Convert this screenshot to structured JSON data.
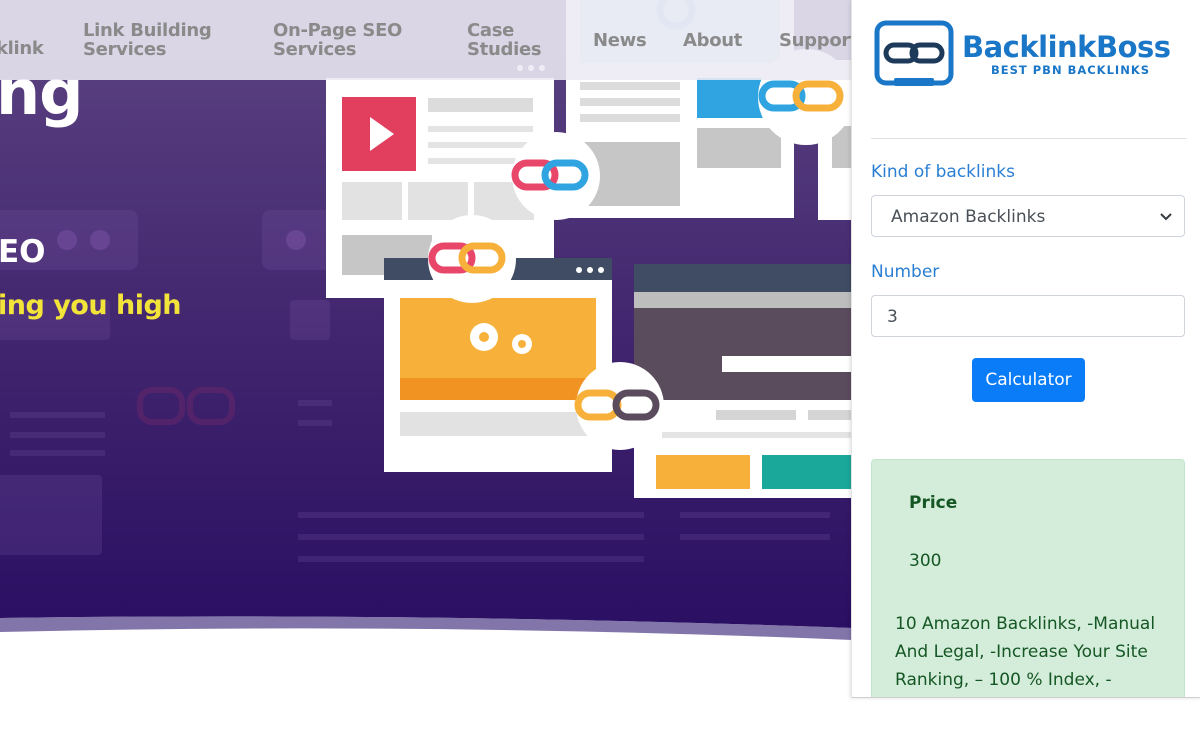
{
  "nav": {
    "items": [
      {
        "line1": "klink",
        "line2": ""
      },
      {
        "line1": "Link Building",
        "line2": "Services"
      },
      {
        "line1": "On-Page SEO",
        "line2": "Services"
      },
      {
        "line1": "Case",
        "line2": "Studies"
      },
      {
        "line1": "News",
        "line2": ""
      },
      {
        "line1": "About",
        "line2": ""
      },
      {
        "line1": "Support",
        "line2": ""
      }
    ]
  },
  "hero": {
    "heading_fragment": "ng",
    "subheading_fragment": "EO",
    "tagline_fragment": "ing you high"
  },
  "panel": {
    "logo": {
      "name": "BacklinkBoss",
      "tagline": "BEST PBN BACKLINKS",
      "icon": "chain-link-icon"
    },
    "kind_label": "Kind of backlinks",
    "kind_value": "Amazon Backlinks",
    "number_label": "Number",
    "number_value": "3",
    "button_label": "Calculator",
    "result": {
      "title": "Price",
      "value": "300",
      "description": "10 Amazon Backlinks, -Manual And Legal, -Increase Your Site Ranking, – 100 % Index, -"
    }
  },
  "colors": {
    "hero_top": "#5a3e80",
    "hero_bottom": "#2a0f63",
    "accent_blue": "#0a7cf8",
    "label_blue": "#2a7fd4",
    "success_bg": "#d4edda",
    "success_text": "#155724",
    "tagline_yellow": "#f3e43a"
  }
}
